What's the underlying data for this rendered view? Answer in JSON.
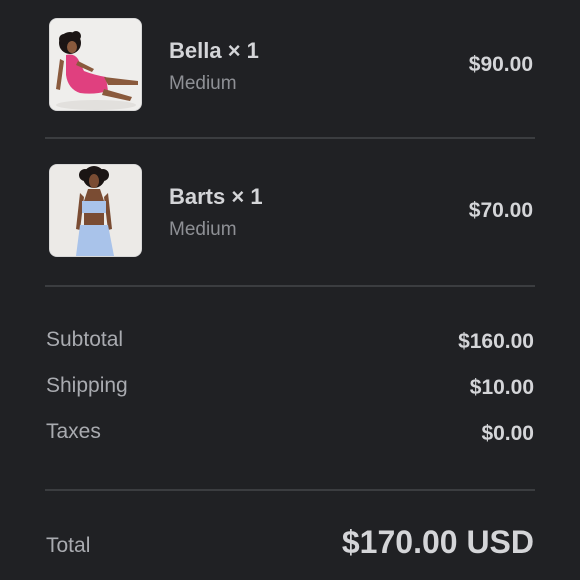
{
  "items": [
    {
      "name": "Bella × 1",
      "variant": "Medium",
      "price": "$90.00",
      "image_icon": "pink-dress-photo",
      "garment_color": "#e0407f"
    },
    {
      "name": "Barts × 1",
      "variant": "Medium",
      "price": "$70.00",
      "image_icon": "blue-two-piece-photo",
      "garment_color": "#a9c3ea"
    }
  ],
  "costs": {
    "subtotal_label": "Subtotal",
    "subtotal_value": "$160.00",
    "shipping_label": "Shipping",
    "shipping_value": "$10.00",
    "taxes_label": "Taxes",
    "taxes_value": "$0.00"
  },
  "total": {
    "label": "Total",
    "value": "$170.00 USD"
  },
  "colors": {
    "background": "#202124",
    "divider": "#3b3d40",
    "primary_text": "#d4d5d8",
    "secondary_text": "#8e9095"
  }
}
